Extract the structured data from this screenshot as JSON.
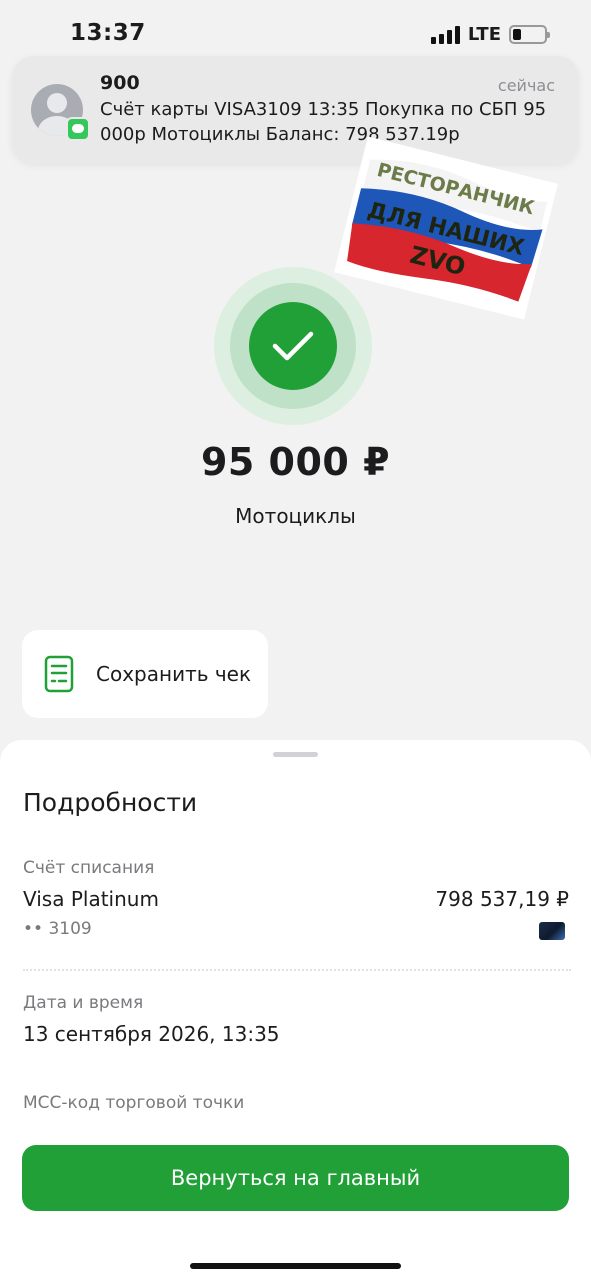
{
  "status_bar": {
    "time": "13:37",
    "network": "LTE"
  },
  "notification": {
    "sender": "900",
    "time": "сейчас",
    "text": "Счёт карты VISA3109 13:35 Покупка по СБП 95 000р Мотоциклы Баланс: 798 537.19р"
  },
  "sticker": {
    "line1": "РЕСТОРАНЧИК",
    "line2": "ДЛЯ НАШИХ",
    "line3": "ZVO"
  },
  "result": {
    "amount": "95 000 ₽",
    "merchant": "Мотоциклы"
  },
  "save_receipt": {
    "label": "Сохранить чек"
  },
  "details": {
    "title": "Подробности",
    "account_label": "Счёт списания",
    "account_name": "Visa Platinum",
    "account_mask": "•• 3109",
    "balance": "798 537,19 ₽",
    "datetime_label": "Дата и время",
    "datetime_value": "13 сентября 2026, 13:35",
    "mcc_label": "МСС-код торговой точки"
  },
  "actions": {
    "home_button": "Вернуться на главный"
  },
  "colors": {
    "accent_green": "#21a038",
    "background": "#f2f2f2"
  }
}
